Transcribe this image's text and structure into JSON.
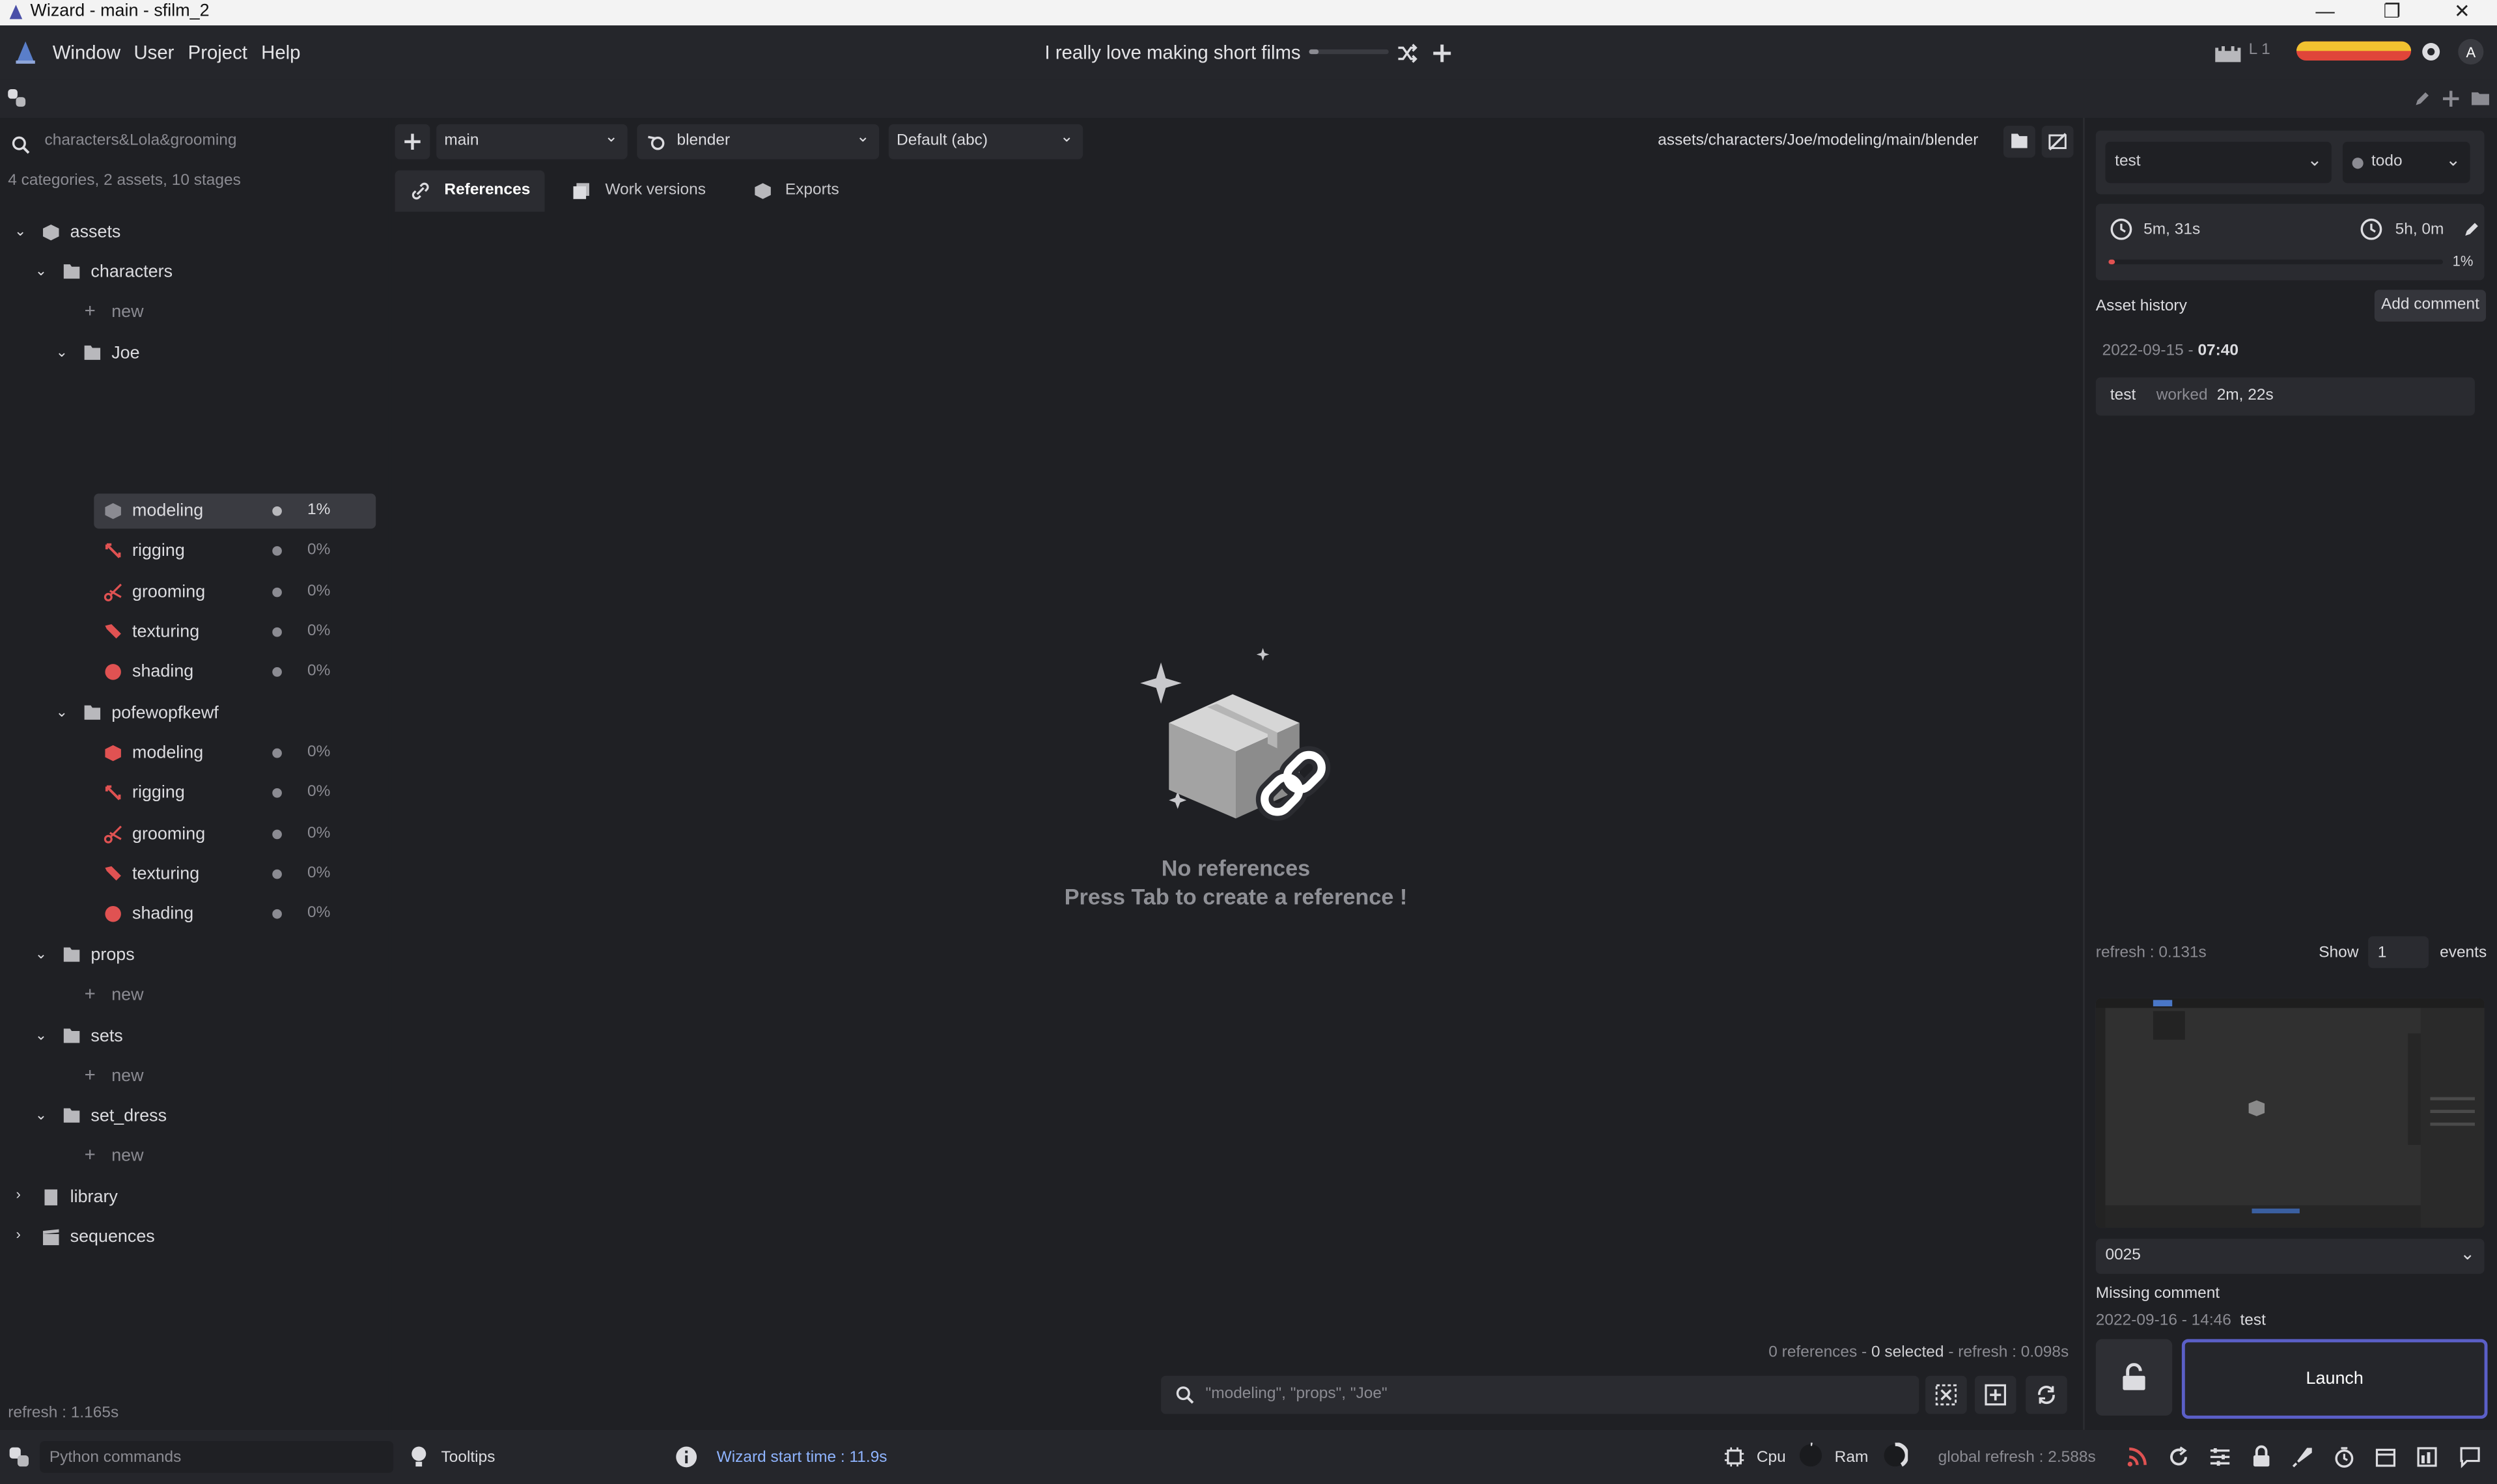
{
  "window": {
    "title": "Wizard - main - sfilm_2",
    "minimize": "—",
    "restore": "❐",
    "close": "✕"
  },
  "menu": {
    "items": [
      "Window",
      "User",
      "Project",
      "Help"
    ],
    "project_title": "I really love making short films",
    "level_label": "L 1"
  },
  "left": {
    "search_placeholder": "characters&Lola&grooming",
    "stats": "4 categories, 2 assets, 10 stages",
    "tree": {
      "assets": "assets",
      "characters": "characters",
      "new": "new",
      "joe": "Joe",
      "pofewopfkewf": "pofewopfkewf",
      "props": "props",
      "sets": "sets",
      "set_dress": "set_dress",
      "library": "library",
      "sequences": "sequences",
      "stages": [
        "modeling",
        "rigging",
        "grooming",
        "texturing",
        "shading"
      ],
      "joe_progress": [
        "1%",
        "0%",
        "0%",
        "0%",
        "0%"
      ],
      "pofe_progress": [
        "0%",
        "0%",
        "0%",
        "0%",
        "0%"
      ]
    },
    "refresh": "refresh : 1.165s"
  },
  "center": {
    "work_env": "main",
    "software": "blender",
    "export": "Default (abc)",
    "path": "assets/characters/Joe/modeling/main/blender",
    "tabs": [
      "References",
      "Work versions",
      "Exports"
    ],
    "empty_title": "No references",
    "empty_sub": "Press Tab to create a reference !",
    "status_refs": "0 references - ",
    "status_selected": "0 selected",
    "status_refresh": " - refresh : 0.098s",
    "search_placeholder": "\"modeling\", \"props\", \"Joe\""
  },
  "right": {
    "user": "test",
    "state": "todo",
    "time_spent": "5m, 31s",
    "estimated": "5h, 0m",
    "progress": "1%",
    "progress_value": 0.01,
    "history_title": "Asset history",
    "add_comment": "Add comment",
    "history_date": "2022-09-15 - ",
    "history_time": "07:40",
    "history_user": "test",
    "history_action": "worked",
    "history_duration": "2m, 22s",
    "refresh": "refresh : 0.131s",
    "show": "Show",
    "show_count": "1",
    "events": "events",
    "version": "0025",
    "missing_comment": "Missing comment",
    "version_date": "2022-09-16 - 14:46",
    "version_user": "test",
    "launch": "Launch"
  },
  "bottom": {
    "python_placeholder": "Python commands",
    "tooltips": "Tooltips",
    "start_time": "Wizard start time : 11.9s",
    "cpu": "Cpu",
    "ram": "Ram",
    "global_refresh": "global refresh : 2.588s"
  },
  "colors": {
    "accent": "#5b5fc7",
    "stage_red": "#e05252",
    "link_blue": "#8fb4ff",
    "energy_yellow": "#f2c230",
    "energy_red": "#e0453a"
  }
}
